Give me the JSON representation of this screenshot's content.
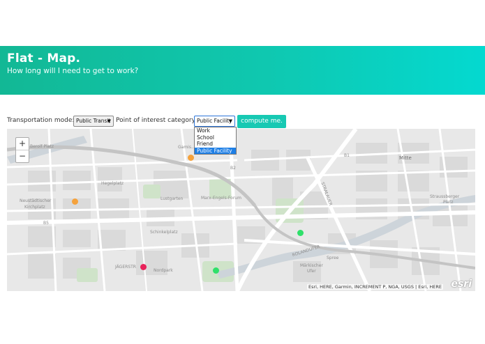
{
  "header": {
    "title": "Flat - Map.",
    "subtitle": "How long will I need to get to work?"
  },
  "controls": {
    "transport_label": "Transportation mode:",
    "transport_value": "Public Transit",
    "category_label": "Point of interest category:",
    "category_value": "Public Facility",
    "compute_label": "compute me."
  },
  "dropdown": {
    "options": [
      "Work",
      "School",
      "Friend",
      "Public Facility"
    ],
    "selected": "Public Facility"
  },
  "map": {
    "zoom_in": "+",
    "zoom_out": "−",
    "attribution": "Esri, HERE, Garmin, INCREMENT P, NGA, USGS | Esri, HERE",
    "logo": "esri",
    "places": {
      "berolfplatz": "Berolf Platz",
      "mitte": "Mitte",
      "hegelplatz": "Hegelplatz",
      "neustaedter": "Neustädtischer",
      "kirchplatz": "Kirchplatz",
      "lustgarten": "Lustgarten",
      "marx_engels": "Marx-Engels-Forum",
      "schinkelplatz": "Schinkelplatz",
      "staussberger": "Straussberger",
      "platz": "Platz",
      "spree": "Spree",
      "maerkisches": "Märkischer",
      "ufer": "Ufer",
      "nordpark": "Nordpark",
      "jaegerstr": "JÄGERSTR",
      "rolanduf": "ROLANDUFER",
      "stralauer": "STRALAUER",
      "b2": "B2",
      "b1": "B1",
      "b5": "B5",
      "grandsmusk": "Gamis..."
    },
    "pois": [
      {
        "name": "poi-orange-1",
        "color": "#f5a23c"
      },
      {
        "name": "poi-orange-2",
        "color": "#f5a23c"
      },
      {
        "name": "poi-green-1",
        "color": "#2fe06a"
      },
      {
        "name": "poi-green-2",
        "color": "#2fe06a"
      },
      {
        "name": "poi-red-1",
        "color": "#e8225a"
      }
    ]
  },
  "colors": {
    "accent": "#17c9b3",
    "hero_start": "#12b895",
    "hero_end": "#04d9d0"
  }
}
